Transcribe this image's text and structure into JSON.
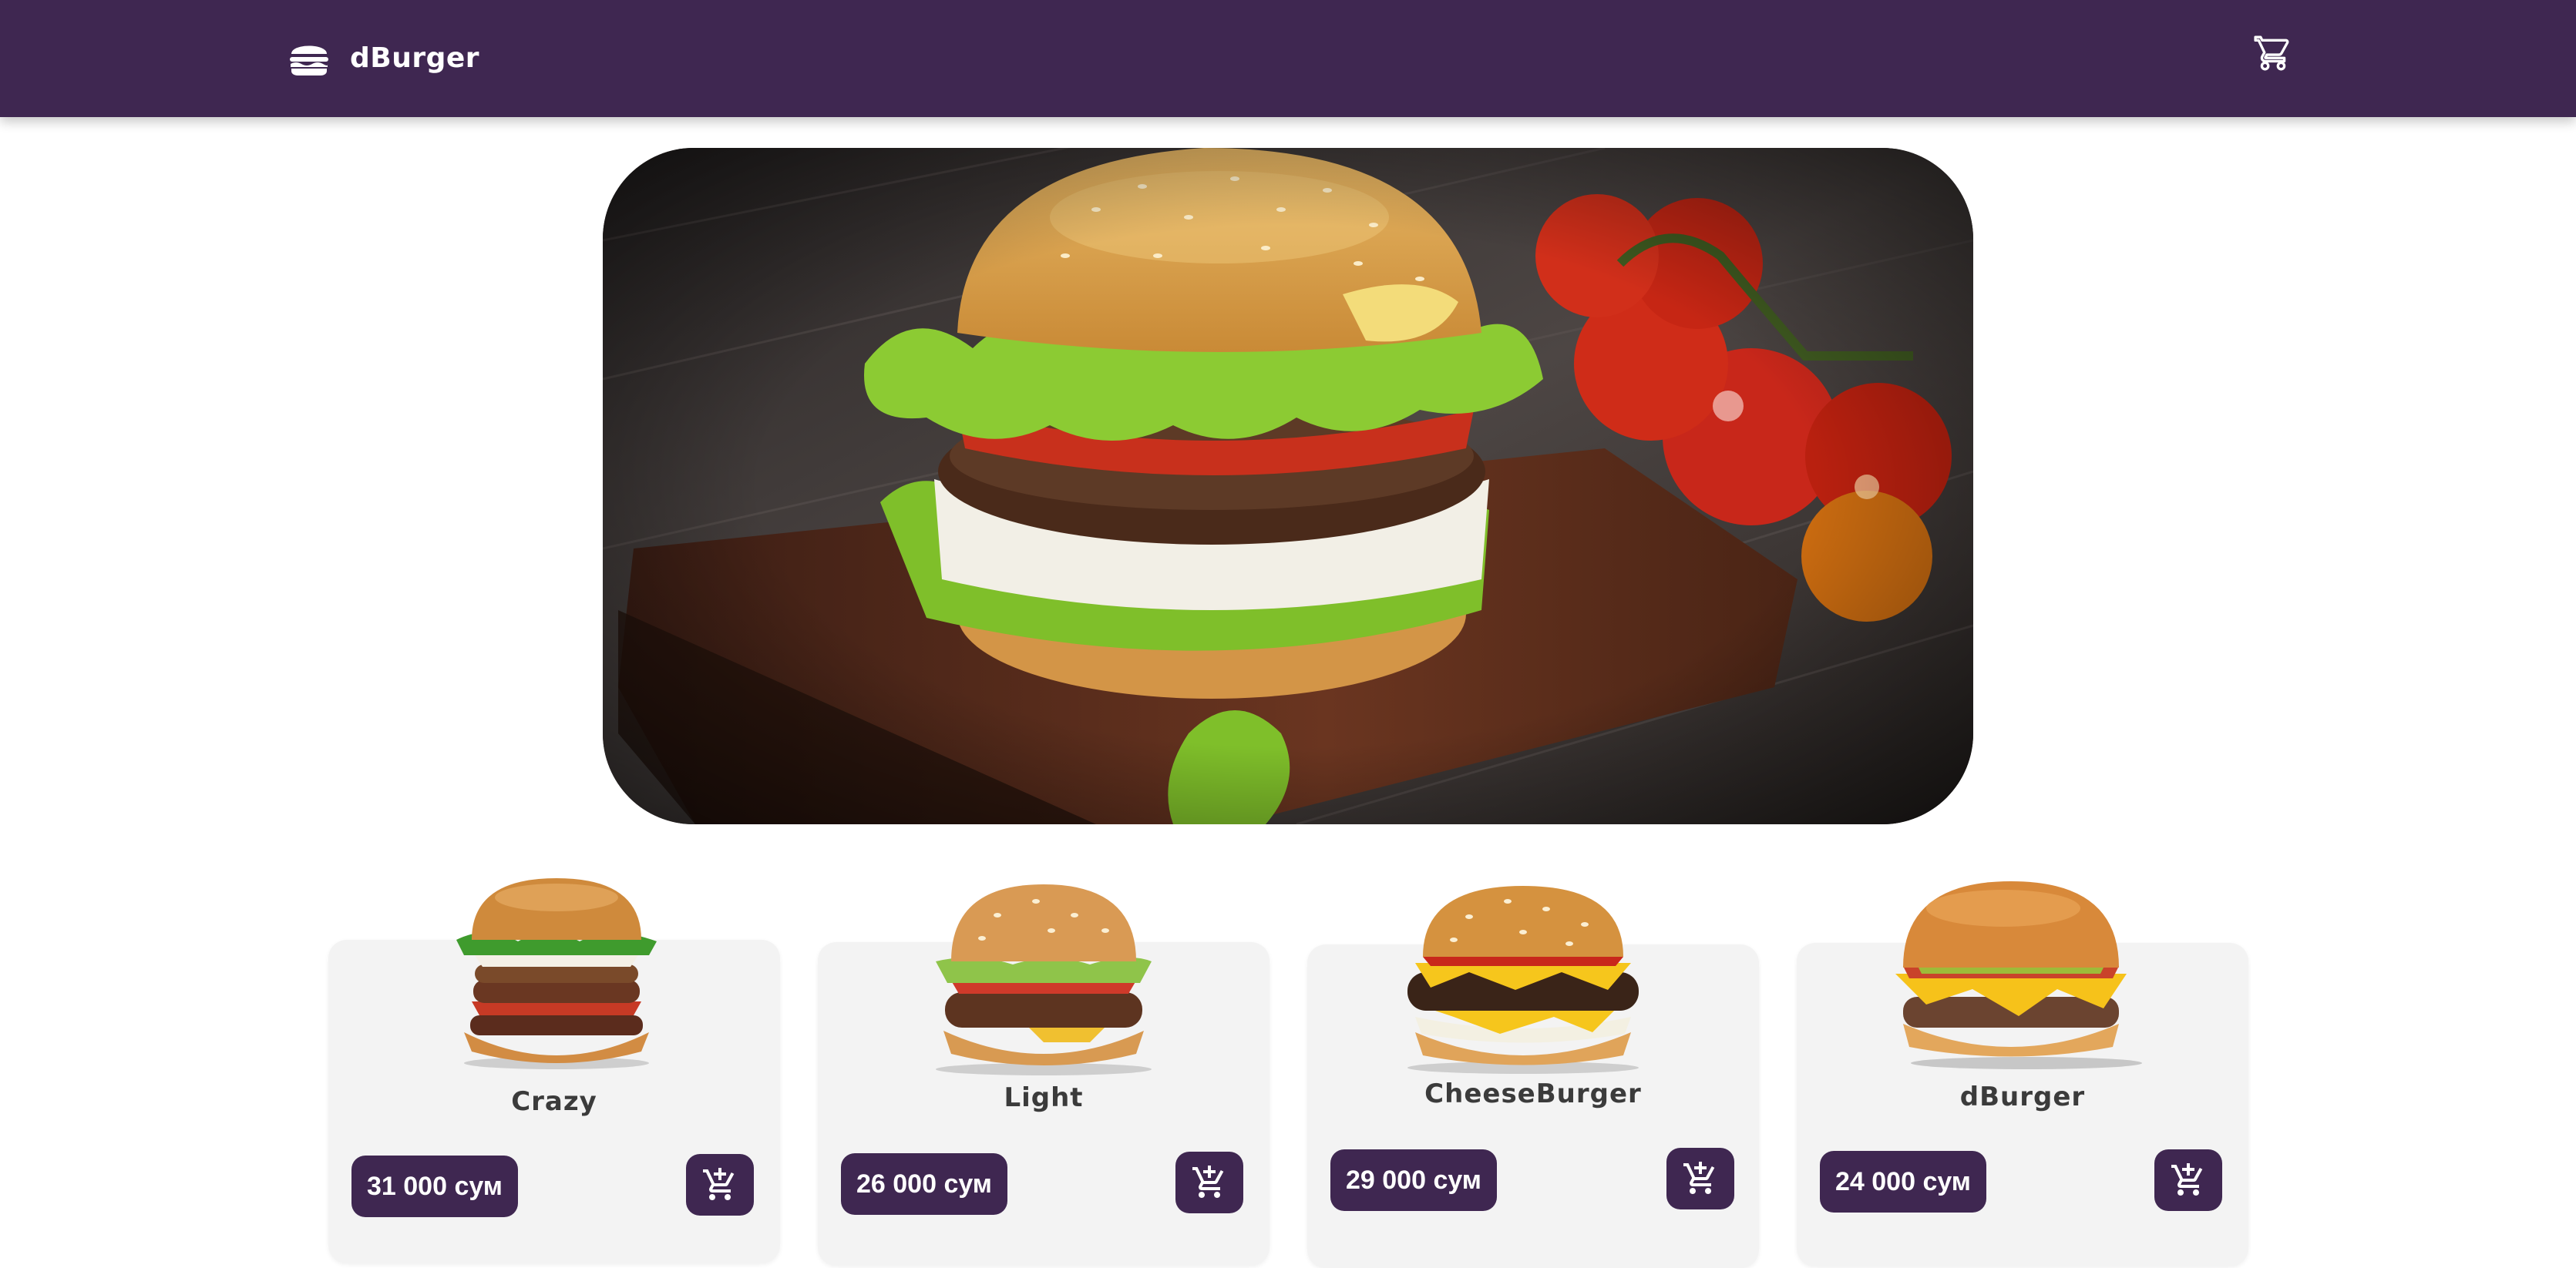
{
  "app": {
    "brand": "dBurger",
    "theme_color": "#3f2751"
  },
  "header": {
    "logo_icon": "burger-icon",
    "cart_icon": "cart-icon"
  },
  "hero": {
    "image": "burger-hero-photo"
  },
  "products": [
    {
      "name": "Crazy",
      "price": "31 000 сум",
      "add_icon": "add-to-cart-icon"
    },
    {
      "name": "Light",
      "price": "26 000 сум",
      "add_icon": "add-to-cart-icon"
    },
    {
      "name": "CheeseBurger",
      "price": "29 000 сум",
      "add_icon": "add-to-cart-icon"
    },
    {
      "name": "dBurger",
      "price": "24 000 сум",
      "add_icon": "add-to-cart-icon"
    }
  ]
}
